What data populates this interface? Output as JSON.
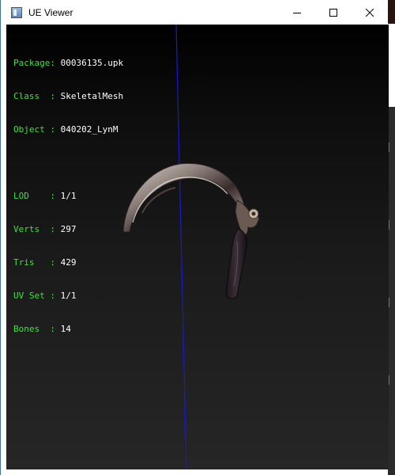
{
  "window": {
    "title": "UE Viewer",
    "icon": "app-window-icon",
    "controls": {
      "minimize_icon": "minimize-icon",
      "maximize_icon": "maximize-icon",
      "close_icon": "close-icon"
    }
  },
  "info": {
    "package_label": "Package:",
    "package_value": "00036135.upk",
    "class_label": "Class  :",
    "class_value": "SkeletalMesh",
    "object_label": "Object :",
    "object_value": "040202_LynM",
    "lod_label": "LOD    :",
    "lod_value": "1/1",
    "verts_label": "Verts  :",
    "verts_value": "297",
    "tris_label": "Tris   :",
    "tris_value": "429",
    "uvset_label": "UV Set :",
    "uvset_value": "1/1",
    "bones_label": "Bones  :",
    "bones_value": "14"
  },
  "colors": {
    "label": "#3fe03f",
    "value": "#ffffff",
    "axis": "#1010c0"
  }
}
